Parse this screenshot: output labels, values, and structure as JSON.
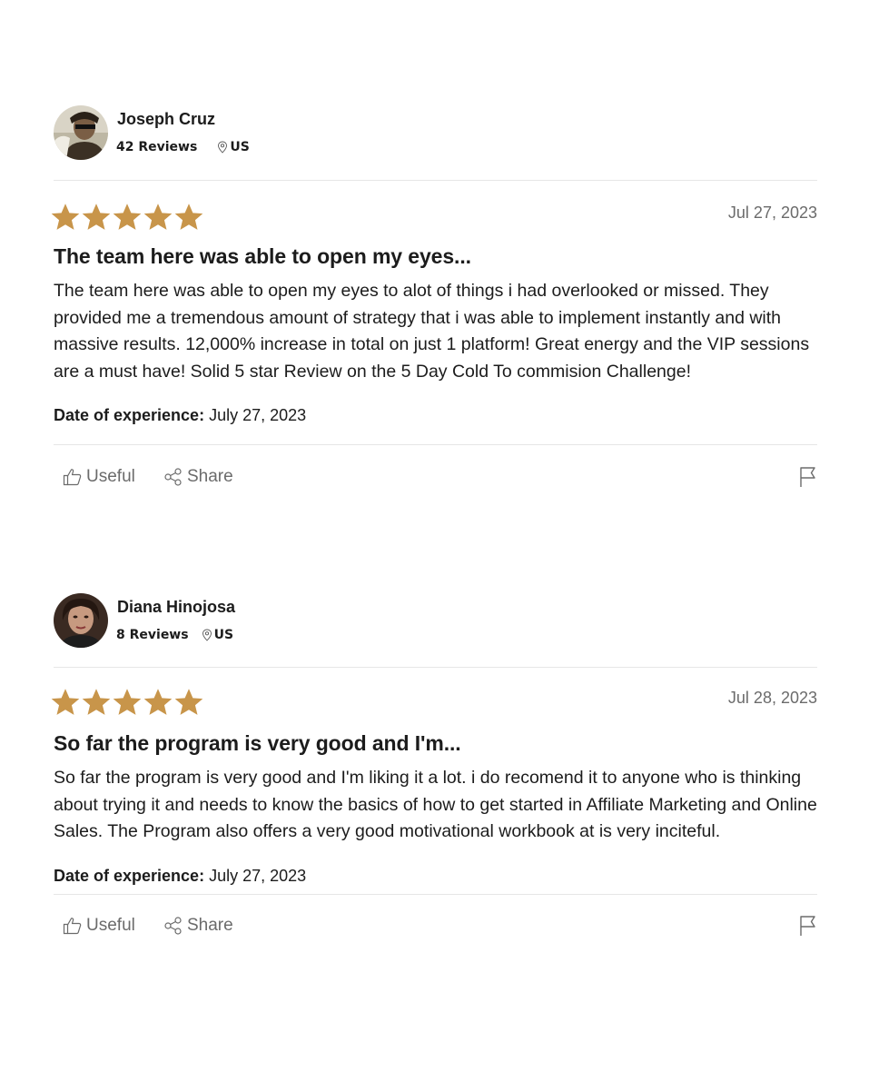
{
  "colors": {
    "star": "#C8954A",
    "text": "#1c1c1c",
    "muted": "#6b6b6b",
    "divider": "#e6e6e6"
  },
  "reviews": [
    {
      "reviewer": {
        "name": "Joseph Cruz",
        "reviews_count": "42 Reviews",
        "location": "US"
      },
      "rating": 5,
      "date": "Jul 27, 2023",
      "title": "The team here was able to open my eyes...",
      "body": "The team here was able to open my eyes to alot of things i had overlooked or missed. They provided me a tremendous amount of strategy that i was able to implement instantly and with massive results. 12,000% increase in total on just 1 platform! Great energy and the VIP sessions are a must have! Solid 5 star Review on the 5 Day Cold To commision Challenge!",
      "experience_label": "Date of experience:",
      "experience_date": "July 27, 2023",
      "useful_label": "Useful",
      "share_label": "Share"
    },
    {
      "reviewer": {
        "name": "Diana Hinojosa",
        "reviews_count": "8 Reviews",
        "location": "US"
      },
      "rating": 5,
      "date": "Jul 28, 2023",
      "title": "So far the program is very good and I'm...",
      "body": "So far the program is very good and I'm liking it a lot. i do recomend it to anyone who is thinking about trying it and needs to know the basics of how to get started in Affiliate Marketing and Online Sales. The Program also offers a very good motivational workbook at is very inciteful.",
      "experience_label": "Date of experience:",
      "experience_date": "July 27, 2023",
      "useful_label": "Useful",
      "share_label": "Share"
    }
  ]
}
